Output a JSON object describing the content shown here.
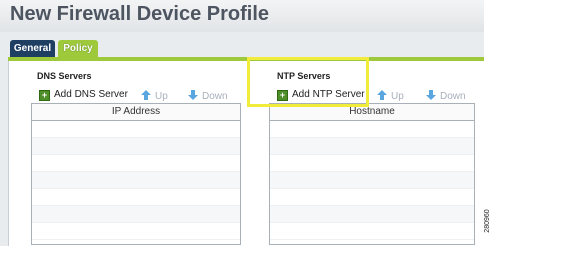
{
  "header": {
    "title": "New Firewall Device Profile"
  },
  "tabs": [
    {
      "label": "General"
    },
    {
      "label": "Policy"
    }
  ],
  "dns": {
    "section_label": "DNS Servers",
    "add_label": "Add DNS Server",
    "up_label": "Up",
    "down_label": "Down",
    "column_header": "IP Address",
    "rows": []
  },
  "ntp": {
    "section_label": "NTP Servers",
    "add_label": "Add NTP Server",
    "up_label": "Up",
    "down_label": "Down",
    "column_header": "Hostname",
    "rows": []
  },
  "figure_id": "280960",
  "colors": {
    "policy_tab": "#9dc93b",
    "general_tab": "#1f3f62",
    "highlight": "#f1ec3b",
    "add_icon": "#4f8f2a",
    "arrow_icon": "#5aa7e0"
  }
}
